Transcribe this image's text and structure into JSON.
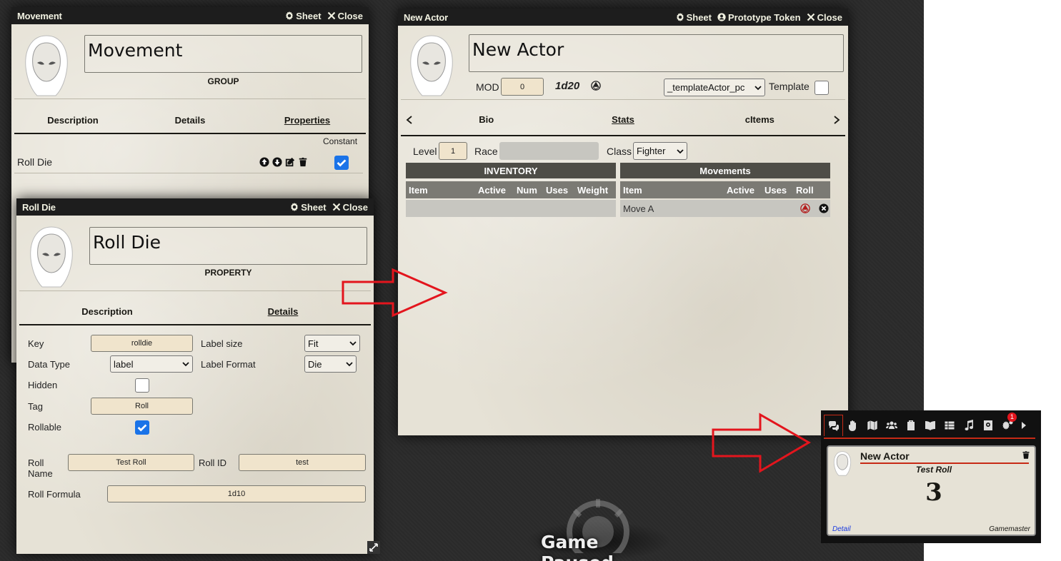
{
  "movement_window": {
    "title": "Movement",
    "sheet_label": "Sheet",
    "close_label": "Close",
    "name": "Movement",
    "type": "GROUP",
    "tabs": [
      "Description",
      "Details",
      "Properties"
    ],
    "constant_header": "Constant",
    "property_row": "Roll Die"
  },
  "rolldie_window": {
    "title": "Roll Die",
    "sheet_label": "Sheet",
    "close_label": "Close",
    "name": "Roll Die",
    "type": "PROPERTY",
    "tabs": [
      "Description",
      "Details"
    ],
    "key_label": "Key",
    "key_value": "rolldie",
    "label_size_label": "Label size",
    "label_size_value": "Fit",
    "data_type_label": "Data Type",
    "data_type_value": "label",
    "label_format_label": "Label Format",
    "label_format_value": "Die",
    "hidden_label": "Hidden",
    "tag_label": "Tag",
    "tag_value": "Roll",
    "rollable_label": "Rollable",
    "roll_name_label": "Roll\nName",
    "roll_name_value": "Test Roll",
    "roll_id_label": "Roll ID",
    "roll_id_value": "test",
    "roll_formula_label": "Roll Formula",
    "roll_formula_value": "1d10"
  },
  "actor_window": {
    "title": "New Actor",
    "sheet_label": "Sheet",
    "prototype_label": "Prototype Token",
    "close_label": "Close",
    "name": "New Actor",
    "mod_label": "MOD",
    "mod_value": "0",
    "dice": "1d20",
    "template_select": "_templateActor_pc",
    "template_label": "Template",
    "tabs": [
      "Bio",
      "Stats",
      "cItems"
    ],
    "level_label": "Level",
    "level_value": "1",
    "race_label": "Race",
    "race_value": "",
    "class_label": "Class",
    "class_value": "Fighter",
    "inventory": {
      "title": "INVENTORY",
      "columns": [
        "Item",
        "Active",
        "Num",
        "Uses",
        "Weight"
      ]
    },
    "movements": {
      "title": "Movements",
      "columns": [
        "Item",
        "Active",
        "Uses",
        "Roll"
      ],
      "rows": [
        "Move A"
      ]
    }
  },
  "chat": {
    "tab_icons": [
      "chat-icon",
      "hand-icon",
      "map-icon",
      "users-icon",
      "cards-icon",
      "book-icon",
      "table-icon",
      "music-icon",
      "compendium-icon",
      "settings-icon",
      "expand-icon"
    ],
    "notification_count": "1",
    "message": {
      "speaker": "New Actor",
      "flavor": "Test Roll",
      "result": "3",
      "detail_link": "Detail",
      "author": "Gamemaster"
    }
  },
  "pause_text": "Game Paused",
  "colors": {
    "header_bg": "#1d1d1d",
    "parchment": "#e6e2d6",
    "field_bg": "#f0e4cc",
    "accent_red": "#c72a16",
    "arrow_red": "#e3151d",
    "checkbox_blue": "#1a73e8"
  }
}
